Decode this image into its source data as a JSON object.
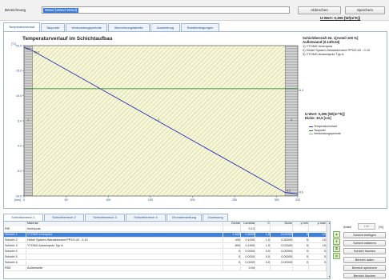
{
  "header": {
    "bezeichnung_label": "Bezeichnung",
    "bezeichnung_value": "Wand (Wand Wand)",
    "cancel_label": "Abbrechen",
    "save_label": "Speichern",
    "uwert_summary": "U-Wert: 0,305 [W/(m²K)]"
  },
  "tabs": [
    {
      "label": "Temperaturverlauf",
      "active": true
    },
    {
      "label": "Taupunkt"
    },
    {
      "label": "Verdunstungsperiode"
    },
    {
      "label": "Berechnungstabelle"
    },
    {
      "label": "Auswertung"
    },
    {
      "label": "Randbedingungen"
    }
  ],
  "info": {
    "bereich": "Schichtbereich Nr. 1[Anteil 100 %]",
    "wand": "Außenwand (0.13/0.04)",
    "layers": [
      "1) YTONG Innenputz",
      "2) Hebel System-Wandelement PP2/0,40 - 0.10",
      "3) YTONG Aussenputz Typ A"
    ],
    "uwert": "U-Wert: 0,305 [W/(m²*K)]",
    "dicke": "Dicke: 32,5 [cm]"
  },
  "legend": [
    {
      "label": "Temperaturverlauf",
      "color": "#2b2bbd"
    },
    {
      "label": "Taupunkt",
      "color": "#1a7a1a"
    },
    {
      "label": "Verdunstungsperiode",
      "color": "#9a9a9a"
    }
  ],
  "chart_data": {
    "type": "line",
    "title": "Temperaturverlauf im Schichtaufbau",
    "ylabel": "[°C]",
    "xlabel": "[mm]",
    "ylim": [
      -10.0,
      20.0
    ],
    "xlim": [
      0,
      325
    ],
    "yticks": [
      "20.0",
      "15.0",
      "10.0",
      "5.0",
      "0.0",
      "-5.0",
      "-10.0"
    ],
    "xticks": [
      "0",
      "50",
      "100",
      "150",
      "200",
      "250",
      "300",
      "325"
    ],
    "layers": [
      {
        "name": "1",
        "from": 0,
        "to": 10
      },
      {
        "name": "2",
        "from": 10,
        "to": 310
      },
      {
        "name": "3",
        "from": 310,
        "to": 325
      }
    ],
    "series": [
      {
        "x": [
          0,
          10,
          310,
          325
        ],
        "y": [
          19.7,
          19.0,
          -9.3,
          -9.6
        ],
        "color": "#2b2bbd"
      },
      {
        "x": [
          0,
          325
        ],
        "y": [
          11.4,
          11.4
        ],
        "color": "#1a7a1a"
      }
    ],
    "point_labels": [
      {
        "text": "19.7",
        "x": 0,
        "y": 19.7
      },
      {
        "text": "19.0",
        "x": 10,
        "y": 19.0
      },
      {
        "text": "11.4",
        "x": 325,
        "y": 11.4
      },
      {
        "text": "-9.3",
        "x": 310,
        "y": -9.3
      },
      {
        "text": "-9.6",
        "x": 325,
        "y": -9.6
      }
    ]
  },
  "bottom_tabs": [
    {
      "label": "Schichtbereich 1",
      "active": true
    },
    {
      "label": "Schichtbereich 2"
    },
    {
      "label": "Schichtbereich 3"
    },
    {
      "label": "Schichtbereich 4"
    },
    {
      "label": "Grundeinstellung"
    },
    {
      "label": "Zuweisung"
    }
  ],
  "table": {
    "headers": [
      "",
      "Material",
      "Dichte",
      "Lambda",
      "C",
      "Dicke",
      "µ min",
      "µ max"
    ],
    "rows": [
      [
        "RSI",
        "Innenputz",
        "",
        "0.13",
        "",
        "",
        "",
        ""
      ],
      [
        "Schicht 1",
        "YTONG Innenputz",
        "1.600",
        "0,3000",
        "1,0",
        "0,01000",
        "5",
        "10"
      ],
      [
        "Schicht 2",
        "Hebel System-Wandelement PP2/0,40 - 0.10",
        "400",
        "0,1000",
        "1,0",
        "0,30000",
        "5",
        "10"
      ],
      [
        "Schicht 3",
        "YTONG Aussenputz Typ A",
        "800",
        "0,1900",
        "1,0",
        "0,01500",
        "5",
        "10"
      ],
      [
        "Schicht 4",
        "",
        "0",
        "0,0000",
        "0,0",
        "0,00000",
        "0",
        "0"
      ],
      [
        "Schicht 5",
        "",
        "0",
        "0,0000",
        "0,0",
        "0,00000",
        "0",
        "0"
      ],
      [
        "Schicht 6",
        "",
        "0",
        "0,0000",
        "0,0",
        "0,00000",
        "0",
        "0"
      ],
      [
        "RSE",
        "Außenseite",
        "",
        "0.04",
        "",
        "",
        "",
        ""
      ]
    ],
    "selected_row": 1
  },
  "right_panel": {
    "anteil_label": "Anteil",
    "anteil_value": "100",
    "anteil_unit": "[%]",
    "buttons": [
      "Schicht einfügen",
      "Schicht editieren",
      "Schicht löschen",
      "Bereich laden",
      "Bereich speichern",
      "Bereich löschen"
    ]
  }
}
